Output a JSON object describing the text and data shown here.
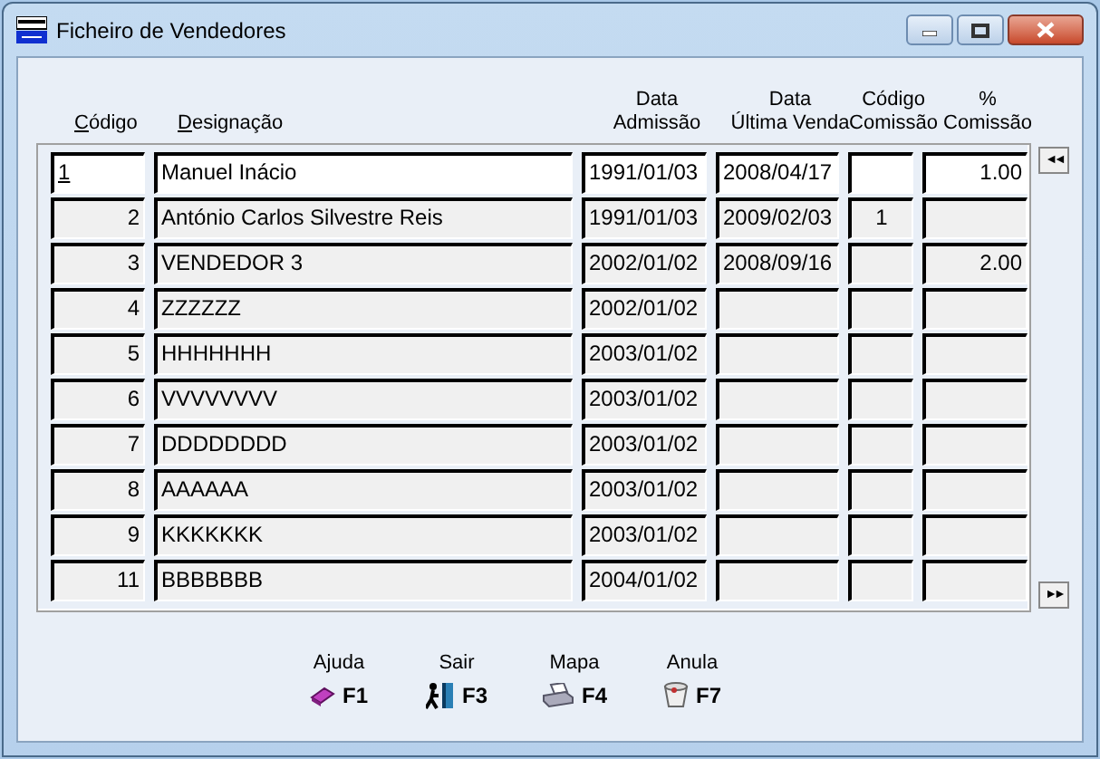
{
  "window": {
    "title": "Ficheiro de Vendedores"
  },
  "table": {
    "columns": [
      {
        "label": "Código",
        "access_key_underlined": true
      },
      {
        "label": "Designação",
        "access_key_underlined": true
      },
      {
        "label": "Data\nAdmissão",
        "access_key_underlined": false
      },
      {
        "label": "Data\nÚltima Venda",
        "access_key_underlined": false
      },
      {
        "label": "Código\nComissão",
        "access_key_underlined": false
      },
      {
        "label": "%\nComissão",
        "access_key_underlined": false
      }
    ],
    "rows": [
      {
        "selected": true,
        "cells": [
          "1",
          "Manuel Inácio",
          "1991/01/03",
          "2008/04/17",
          "",
          "1.00"
        ]
      },
      {
        "selected": false,
        "cells": [
          "2",
          "António Carlos Silvestre Reis",
          "1991/01/03",
          "2009/02/03",
          "1",
          ""
        ]
      },
      {
        "selected": false,
        "cells": [
          "3",
          "VENDEDOR 3",
          "2002/01/02",
          "2008/09/16",
          "",
          "2.00"
        ]
      },
      {
        "selected": false,
        "cells": [
          "4",
          "ZZZZZZ",
          "2002/01/02",
          "",
          "",
          ""
        ]
      },
      {
        "selected": false,
        "cells": [
          "5",
          "HHHHHHH",
          "2003/01/02",
          "",
          "",
          ""
        ]
      },
      {
        "selected": false,
        "cells": [
          "6",
          "VVVVVVVV",
          "2003/01/02",
          "",
          "",
          ""
        ]
      },
      {
        "selected": false,
        "cells": [
          "7",
          "DDDDDDDD",
          "2003/01/02",
          "",
          "",
          ""
        ]
      },
      {
        "selected": false,
        "cells": [
          "8",
          "AAAAAA",
          "2003/01/02",
          "",
          "",
          ""
        ]
      },
      {
        "selected": false,
        "cells": [
          "9",
          "KKKKKKK",
          "2003/01/02",
          "",
          "",
          ""
        ]
      },
      {
        "selected": false,
        "cells": [
          "11",
          "BBBBBBB",
          "2004/01/02",
          "",
          "",
          ""
        ]
      }
    ]
  },
  "scroll_buttons": [
    {
      "label": "◄◄"
    },
    {
      "label": "►►"
    }
  ],
  "function_keys": [
    {
      "kind": "help",
      "label": "Ajuda",
      "key": "F1"
    },
    {
      "kind": "exit",
      "label": "Sair",
      "key": "F3"
    },
    {
      "kind": "print",
      "label": "Mapa",
      "key": "F4"
    },
    {
      "kind": "cancel",
      "label": "Anula",
      "key": "F7"
    }
  ]
}
